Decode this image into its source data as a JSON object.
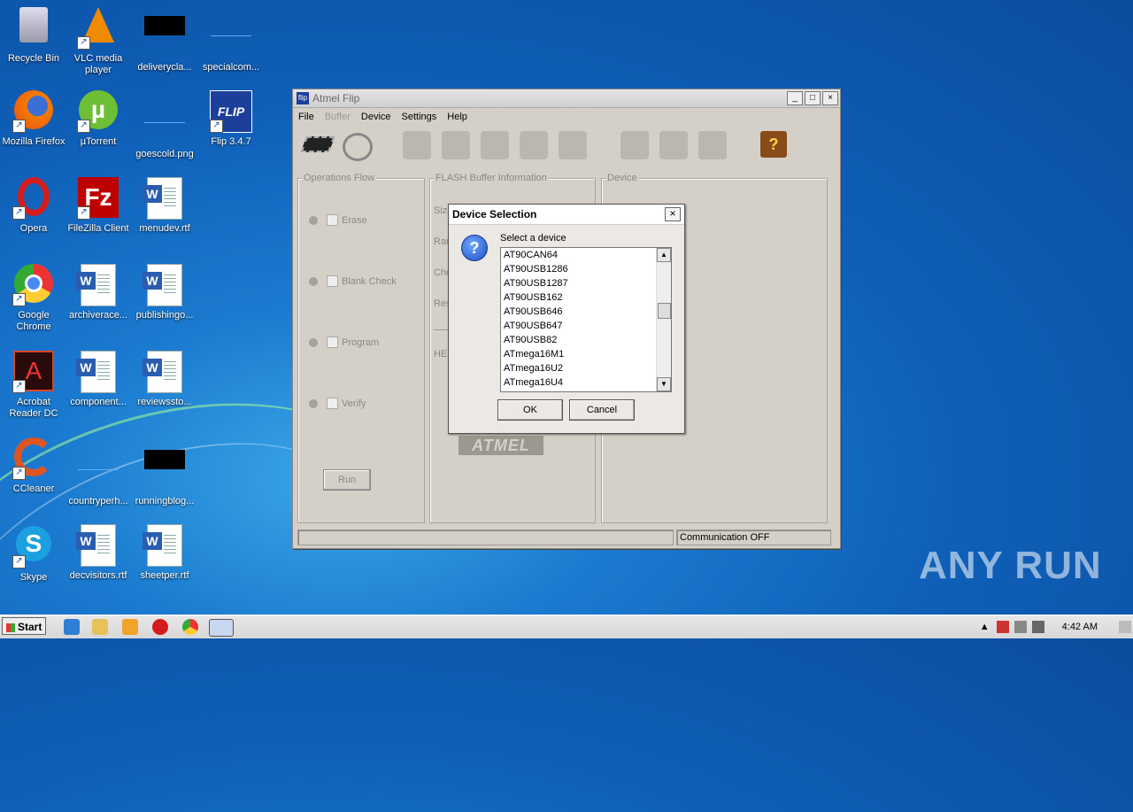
{
  "desktop": {
    "icons": [
      {
        "label": "Recycle Bin",
        "icon": "recycle-bin-icon"
      },
      {
        "label": "VLC media player",
        "icon": "vlc-icon"
      },
      {
        "label": "deliverycla...",
        "icon": "file-icon"
      },
      {
        "label": "specialcom...",
        "icon": "file-icon"
      },
      {
        "label": "Mozilla Firefox",
        "icon": "firefox-icon"
      },
      {
        "label": "µTorrent",
        "icon": "utorrent-icon"
      },
      {
        "label": "goescold.png",
        "icon": "image-file-icon"
      },
      {
        "label": "Flip 3.4.7",
        "icon": "flip-icon"
      },
      {
        "label": "Opera",
        "icon": "opera-icon"
      },
      {
        "label": "FileZilla Client",
        "icon": "filezilla-icon"
      },
      {
        "label": "menudev.rtf",
        "icon": "word-doc-icon"
      },
      {
        "label": "Google Chrome",
        "icon": "chrome-icon"
      },
      {
        "label": "archiverace...",
        "icon": "word-doc-icon"
      },
      {
        "label": "publishingo...",
        "icon": "word-doc-icon"
      },
      {
        "label": "Acrobat Reader DC",
        "icon": "acrobat-icon"
      },
      {
        "label": "component...",
        "icon": "word-doc-icon"
      },
      {
        "label": "reviewssto...",
        "icon": "word-doc-icon"
      },
      {
        "label": "CCleaner",
        "icon": "ccleaner-icon"
      },
      {
        "label": "countryperh...",
        "icon": "file-icon"
      },
      {
        "label": "runningblog...",
        "icon": "file-icon"
      },
      {
        "label": "Skype",
        "icon": "skype-icon"
      },
      {
        "label": "decvisitors.rtf",
        "icon": "word-doc-icon"
      },
      {
        "label": "sheetper.rtf",
        "icon": "word-doc-icon"
      }
    ]
  },
  "flip": {
    "title": "Atmel Flip",
    "app_icon_text": "flip",
    "menu": [
      "File",
      "Buffer",
      "Device",
      "Settings",
      "Help"
    ],
    "groups": {
      "operations": "Operations Flow",
      "buffer": "FLASH Buffer Information",
      "device": "Device"
    },
    "operations": [
      "Erase",
      "Blank Check",
      "Program",
      "Verify"
    ],
    "run": "Run",
    "buffer_labels": [
      "Size",
      "Ran",
      "Che",
      "Res",
      "HEX"
    ],
    "logo": "ATMEL",
    "status_left": "",
    "status_right": "Communication OFF"
  },
  "dialog": {
    "title": "Device Selection",
    "prompt": "Select a device",
    "devices": [
      "AT90CAN64",
      "AT90USB1286",
      "AT90USB1287",
      "AT90USB162",
      "AT90USB646",
      "AT90USB647",
      "AT90USB82",
      "ATmega16M1",
      "ATmega16U2",
      "ATmega16U4"
    ],
    "ok": "OK",
    "cancel": "Cancel"
  },
  "taskbar": {
    "start": "Start",
    "clock": "4:42 AM"
  },
  "watermark": "ANY RUN"
}
